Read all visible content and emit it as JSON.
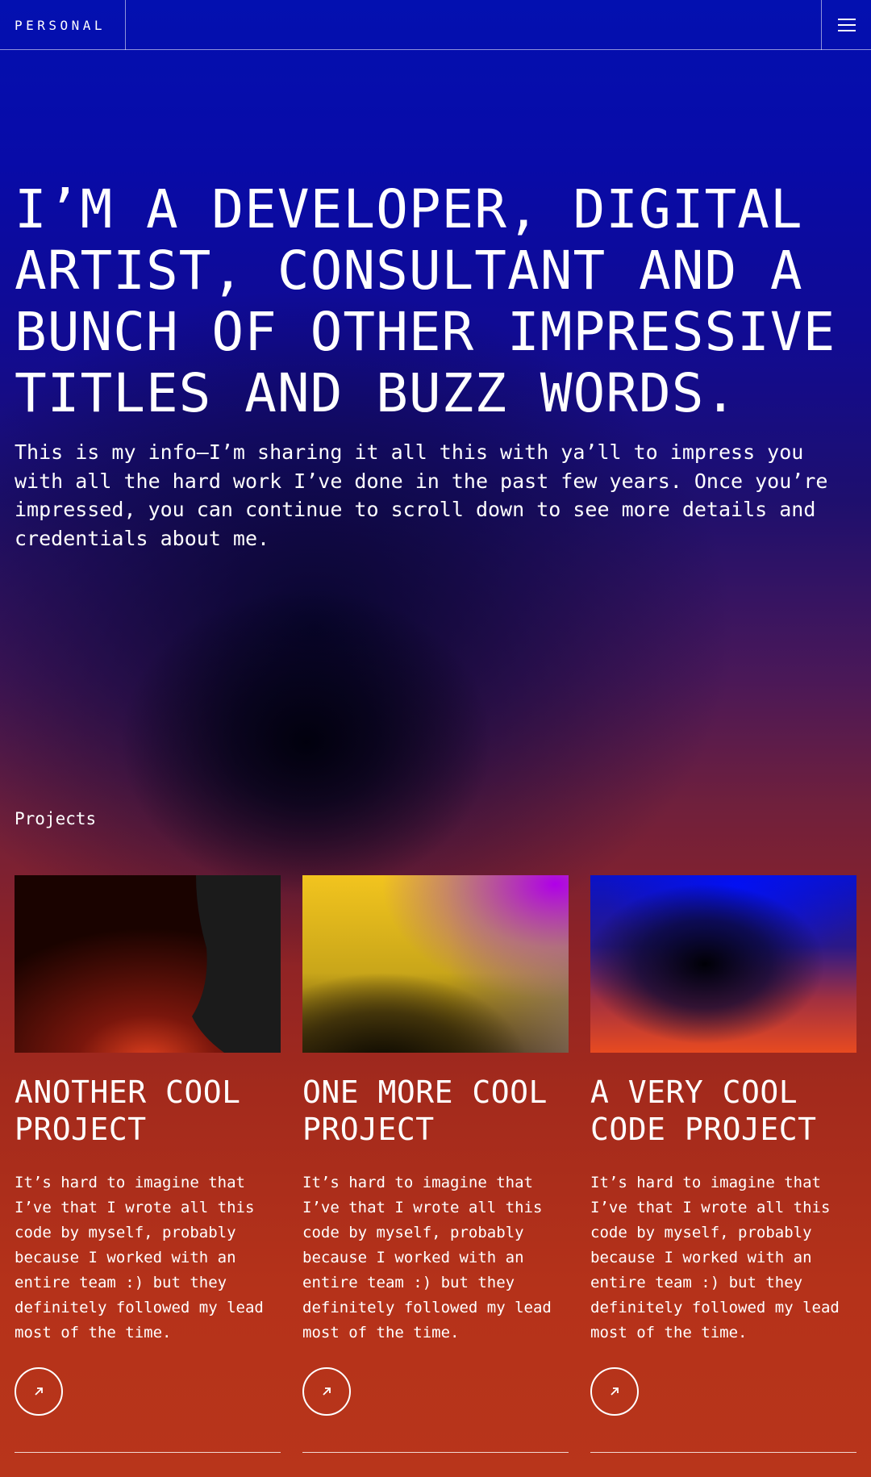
{
  "header": {
    "brand": "PERSONAL",
    "menu_icon": "hamburger-menu-icon"
  },
  "hero": {
    "title": "I’M A DEVELOPER, DIGITAL ARTIST, CONSULTANT AND A BUNCH OF OTHER IMPRESSIVE TITLES AND BUZZ WORDS.",
    "intro": "This is my info—I’m sharing it all this with ya’ll to impress you with all the hard work I’ve done in the past few years. Once you’re impressed, you can continue to scroll down to see more details and credentials about me."
  },
  "projects": {
    "label": "Projects",
    "items": [
      {
        "title": "ANOTHER COOL PROJECT",
        "description": "It’s hard to imagine that I’ve that I wrote all this code by myself, probably because I worked with an entire team :) but they definitely followed my lead most of the time.",
        "link_icon": "arrow-up-right-icon"
      },
      {
        "title": "ONE MORE COOL PROJECT",
        "description": "It’s hard to imagine that I’ve that I wrote all this code by myself, probably because I worked with an entire team :) but they definitely followed my lead most of the time.",
        "link_icon": "arrow-up-right-icon"
      },
      {
        "title": "A VERY COOL CODE PROJECT",
        "description": "It’s hard to imagine that I’ve that I wrote all this code by myself, probably because I worked with an entire team :) but they definitely followed my lead most of the time.",
        "link_icon": "arrow-up-right-icon"
      }
    ]
  },
  "colors": {
    "header_blue": "#0310b0",
    "footer_orange": "#b8351b",
    "text": "#ffffff"
  }
}
